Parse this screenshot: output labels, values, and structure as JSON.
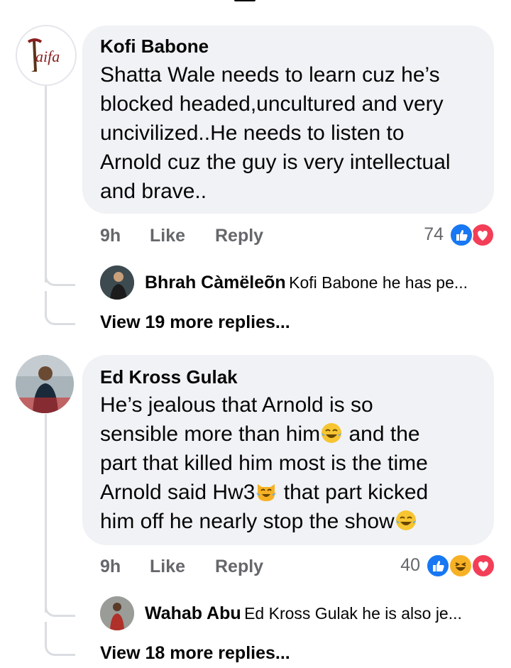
{
  "comments": [
    {
      "author": "Kofi Babone",
      "avatar_logo": "Taifa",
      "lines": [
        "Shatta Wale needs to learn cuz he’s",
        "blocked headed,uncultured and very",
        "uncivilized..He needs to listen to",
        "Arnold cuz the guy is very intellectual",
        "and brave.."
      ],
      "time": "9h",
      "like_label": "Like",
      "reply_label": "Reply",
      "reaction_count": "74",
      "reactions": [
        "like",
        "love"
      ],
      "reply_preview": {
        "name": "Bhrah Càmëleõn",
        "text": "Kofi Babone he has pe..."
      },
      "view_more": "View 19 more replies..."
    },
    {
      "author": "Ed Kross Gulak",
      "line1": "He’s jealous that Arnold is so",
      "line2_a": "sensible more than him",
      "line2_b": " and the",
      "line3": "part that killed him most is the time",
      "line4_a": "Arnold said Hw3",
      "line4_b": " that part kicked",
      "line5_a": "him off he nearly stop the show",
      "emojis": [
        "tears-of-joy",
        "crying-cat",
        "tears-of-joy"
      ],
      "time": "9h",
      "like_label": "Like",
      "reply_label": "Reply",
      "reaction_count": "40",
      "reactions": [
        "like",
        "haha",
        "love"
      ],
      "reply_preview": {
        "name": "Wahab Abu",
        "text": "Ed Kross Gulak he is also je..."
      },
      "view_more": "View 18 more replies..."
    }
  ],
  "colors": {
    "like": "#1877f2",
    "love": "#f33e58",
    "haha": "#f7b125",
    "bubble": "#f0f2f5",
    "meta": "#65676b"
  }
}
